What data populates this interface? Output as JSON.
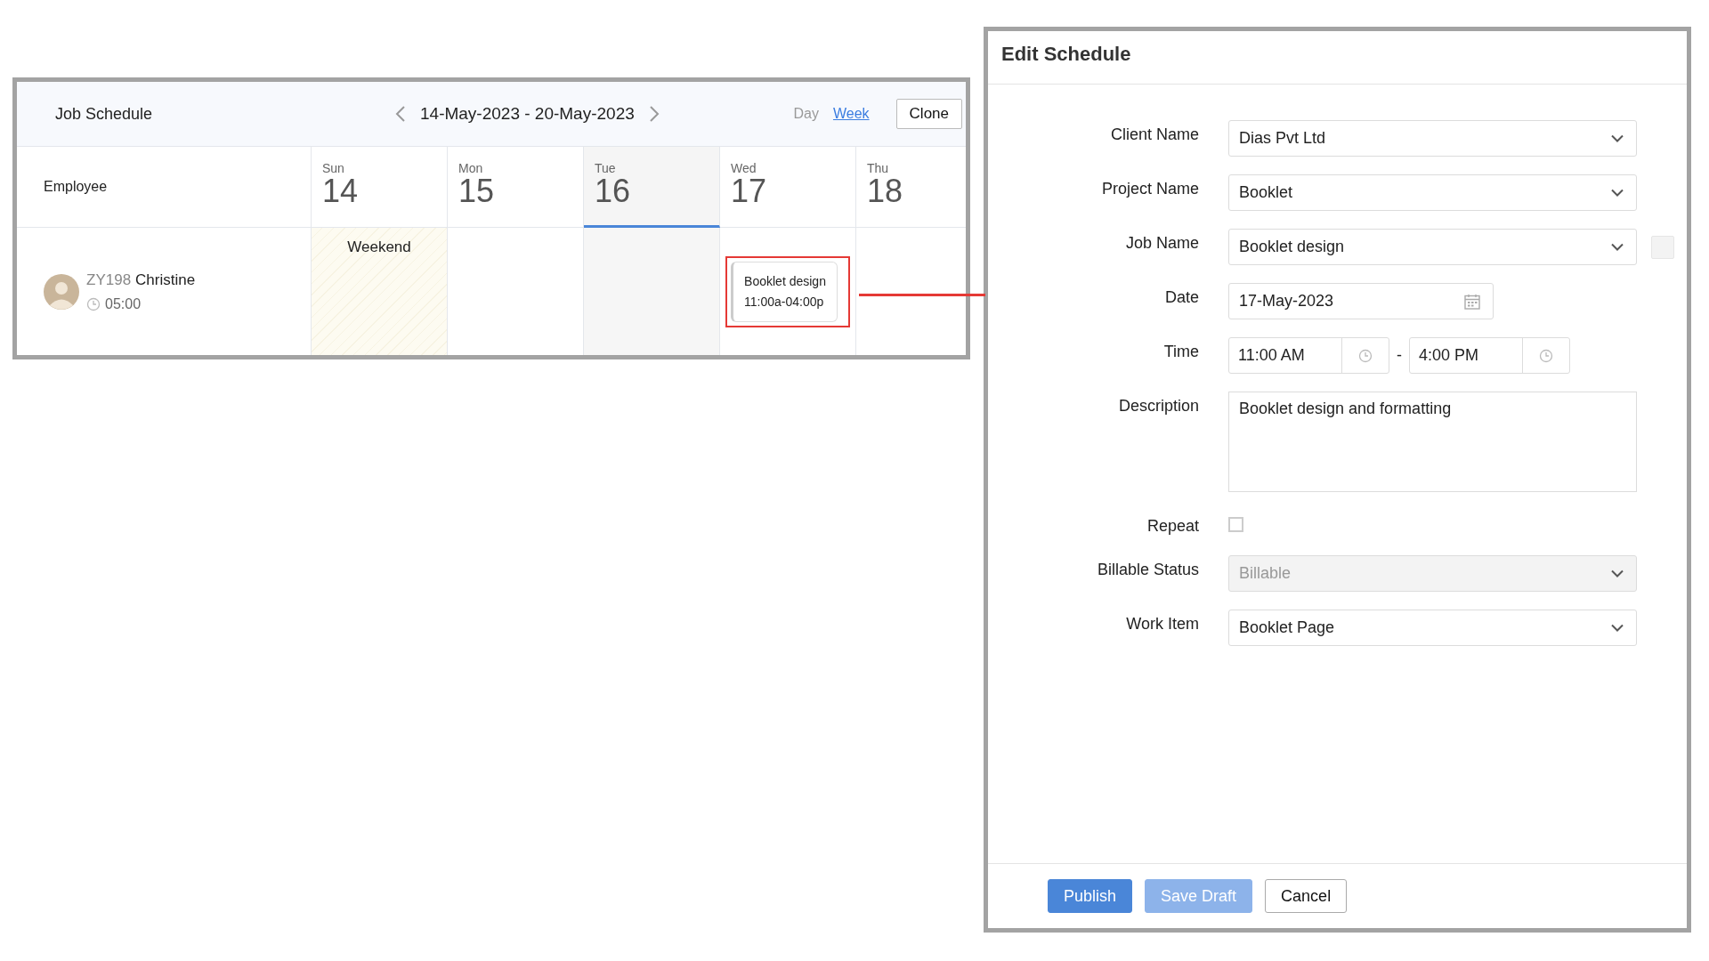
{
  "schedule": {
    "title": "Job Schedule",
    "range": "14-May-2023 - 20-May-2023",
    "views": [
      {
        "label": "Day",
        "selected": false
      },
      {
        "label": "Week",
        "selected": true
      }
    ],
    "clone": "Clone",
    "employee_header": "Employee",
    "days": [
      {
        "weekday": "Sun",
        "date": "14",
        "selected": false
      },
      {
        "weekday": "Mon",
        "date": "15",
        "selected": false
      },
      {
        "weekday": "Tue",
        "date": "16",
        "selected": true
      },
      {
        "weekday": "Wed",
        "date": "17",
        "selected": false
      },
      {
        "weekday": "Thu",
        "date": "18",
        "selected": false
      }
    ],
    "rows": [
      {
        "code": "ZY198",
        "name": "Christine",
        "hours": "05:00",
        "cells": [
          {
            "kind": "weekend",
            "label": "Weekend"
          },
          {
            "kind": "empty"
          },
          {
            "kind": "empty"
          },
          {
            "kind": "event",
            "title": "Booklet design",
            "time": "11:00a-04:00p",
            "highlighted": true
          },
          {
            "kind": "empty"
          }
        ]
      }
    ]
  },
  "edit": {
    "title": "Edit Schedule",
    "fields": [
      {
        "kind": "select",
        "label": "Client Name",
        "value": "Dias Pvt Ltd",
        "disabled": false,
        "swatch": false
      },
      {
        "kind": "select",
        "label": "Project Name",
        "value": "Booklet",
        "disabled": false,
        "swatch": false
      },
      {
        "kind": "select",
        "label": "Job Name",
        "value": "Booklet design",
        "disabled": false,
        "swatch": true
      },
      {
        "kind": "date",
        "label": "Date",
        "value": "17-May-2023"
      },
      {
        "kind": "timerange",
        "label": "Time",
        "from": "11:00 AM",
        "separator": "-",
        "to": "4:00 PM"
      },
      {
        "kind": "textarea",
        "label": "Description",
        "value": "Booklet design and formatting"
      },
      {
        "kind": "checkbox",
        "label": "Repeat",
        "checked": false
      },
      {
        "kind": "select",
        "label": "Billable Status",
        "value": "Billable",
        "disabled": true,
        "swatch": false
      },
      {
        "kind": "select",
        "label": "Work Item",
        "value": "Booklet Page",
        "disabled": false,
        "swatch": false
      }
    ],
    "buttons": [
      {
        "label": "Publish",
        "kind": "primary",
        "disabled": false
      },
      {
        "label": "Save Draft",
        "kind": "primary",
        "disabled": true
      },
      {
        "label": "Cancel",
        "kind": "secondary",
        "disabled": false
      }
    ]
  }
}
